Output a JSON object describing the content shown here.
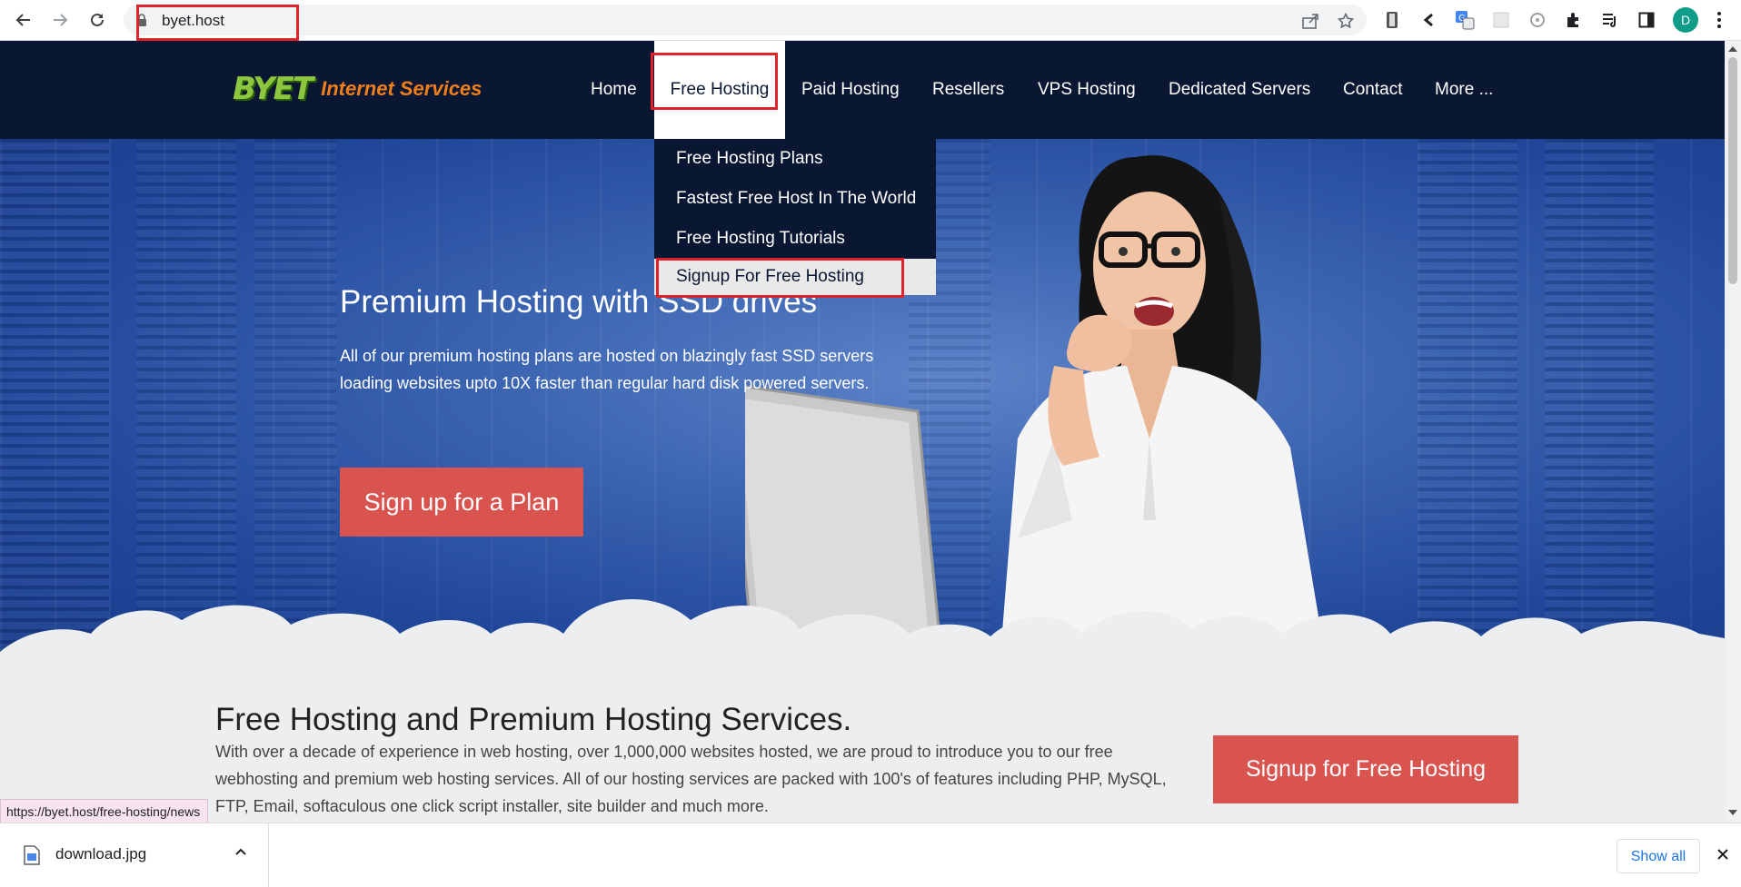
{
  "browser": {
    "url": "byet.host",
    "status_url": "https://byet.host/free-hosting/news",
    "profile_initial": "D",
    "icons": [
      "back-icon",
      "forward-icon",
      "reload-icon",
      "lock-icon",
      "share-icon",
      "star-icon",
      "extension-icon",
      "puzzle-icon",
      "media-icon",
      "sidepanel-icon",
      "menu-icon"
    ]
  },
  "site": {
    "logo_mark": "BYET",
    "logo_text": "Internet Services",
    "menu": [
      {
        "label": "Home"
      },
      {
        "label": "Free Hosting"
      },
      {
        "label": "Paid Hosting"
      },
      {
        "label": "Resellers"
      },
      {
        "label": "VPS Hosting"
      },
      {
        "label": "Dedicated Servers"
      },
      {
        "label": "Contact"
      },
      {
        "label": "More ..."
      }
    ],
    "dropdown": [
      {
        "label": "Free Hosting Plans"
      },
      {
        "label": "Fastest Free Host In The World"
      },
      {
        "label": "Free Hosting Tutorials"
      },
      {
        "label": "Signup For Free Hosting"
      }
    ]
  },
  "hero": {
    "title": "Premium Hosting with SSD drives",
    "text": "All of our premium hosting plans are hosted on blazingly fast SSD servers loading websites upto 10X faster than regular hard disk powered servers.",
    "button": "Sign up for a Plan"
  },
  "content": {
    "title": "Free Hosting and Premium Hosting Services.",
    "text": "With over a decade of experience in web hosting, over 1,000,000 websites hosted, we are proud to introduce you to our free webhosting and premium web hosting services. All of our hosting services are packed with 100's of features including PHP, MySQL, FTP, Email, softaculous one click script installer, site builder and much more.",
    "button": "Signup for Free Hosting"
  },
  "downloads": {
    "file_name": "download.jpg",
    "show_all": "Show all"
  },
  "colors": {
    "header_bg": "#0a1733",
    "accent_red": "#d9534f",
    "highlight_red": "#e0222a",
    "logo_green": "#8dc63f",
    "logo_orange": "#f07f1a"
  }
}
